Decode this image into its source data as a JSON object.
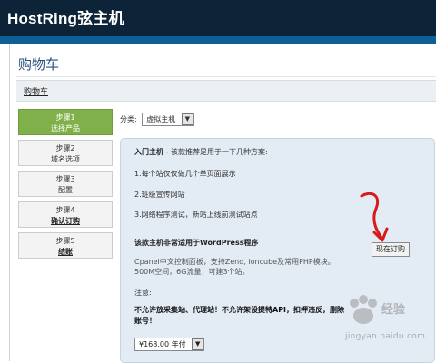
{
  "header": {
    "brand": "HostRing弦主机"
  },
  "page": {
    "title": "购物车"
  },
  "breadcrumb": {
    "label": "购物车"
  },
  "steps": [
    {
      "title": "步骤1",
      "subtitle": "选择产品",
      "active": true
    },
    {
      "title": "步骤2",
      "subtitle": "域名选项",
      "active": false
    },
    {
      "title": "步骤3",
      "subtitle": "配置",
      "active": false
    },
    {
      "title": "步骤4",
      "subtitle": "确认订购",
      "active": false
    },
    {
      "title": "步骤5",
      "subtitle": "结账",
      "active": false
    }
  ],
  "category": {
    "label": "分类:",
    "selected": "虚拟主机"
  },
  "product": {
    "name": "入门主机",
    "intro": " - 该款推荐是用于一下几种方案:",
    "options": [
      "1.每个站仅仅做几个单页面展示",
      "2.班级宣传网站",
      "3.网络程序测试，新站上线前测试站点"
    ],
    "recommend": "该款主机非常适用于WordPress程序",
    "order_label": "现在订购",
    "features_line1": "Cpanel中文控制面板，支持Zend, ioncube及常用PHP模块。",
    "features_line2": "500M空间，6G流量，可建3个站。",
    "note_label": "注意:",
    "warning": "不允许放采集站、代理站！不允许架设提特API，扣押违反，删除账号！",
    "price": "¥168.00 年付"
  },
  "watermark": {
    "text_cn": "经验",
    "text_url": "jingyan.baidu.com"
  },
  "colors": {
    "topbar": "#0d2438",
    "accent_bar": "#0e5f93",
    "step_active": "#80b04a",
    "panel": "#e3ebf5",
    "annotation": "#d81a1a"
  }
}
